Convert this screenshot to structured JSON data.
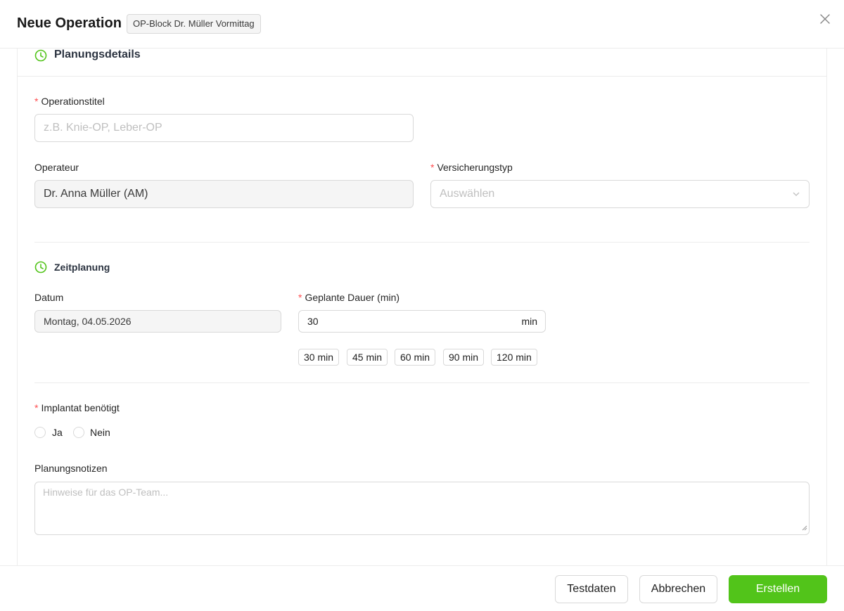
{
  "header": {
    "title": "Neue Operation",
    "badge": "OP-Block Dr. Müller Vormittag",
    "close_icon": "close-icon"
  },
  "colors": {
    "accent": "#52c41a",
    "required": "#ff4d4f",
    "border": "#d9d9d9"
  },
  "planning": {
    "section_title": "Planungsdetails",
    "section_icon": "clock-icon",
    "title_label": "Operationstitel",
    "title_placeholder": "z.B. Knie-OP, Leber-OP",
    "operator_label": "Operateur",
    "operator_value": "Dr. Anna Müller (AM)",
    "insurance_label": "Versicherungstyp",
    "insurance_placeholder": "Auswählen"
  },
  "schedule": {
    "section_title": "Zeitplanung",
    "section_icon": "clock-icon",
    "date_label": "Datum",
    "date_value": "Montag, 04.05.2026",
    "duration_label": "Geplante Dauer (min)",
    "duration_value": "30",
    "duration_suffix": "min",
    "presets": [
      "30 min",
      "45 min",
      "60 min",
      "90 min",
      "120 min"
    ]
  },
  "implant": {
    "label": "Implantat benötigt",
    "options": [
      "Ja",
      "Nein"
    ]
  },
  "notes": {
    "label": "Planungsnotizen",
    "placeholder": "Hinweise für das OP-Team..."
  },
  "footer": {
    "testdata_label": "Testdaten",
    "cancel_label": "Abbrechen",
    "create_label": "Erstellen"
  }
}
